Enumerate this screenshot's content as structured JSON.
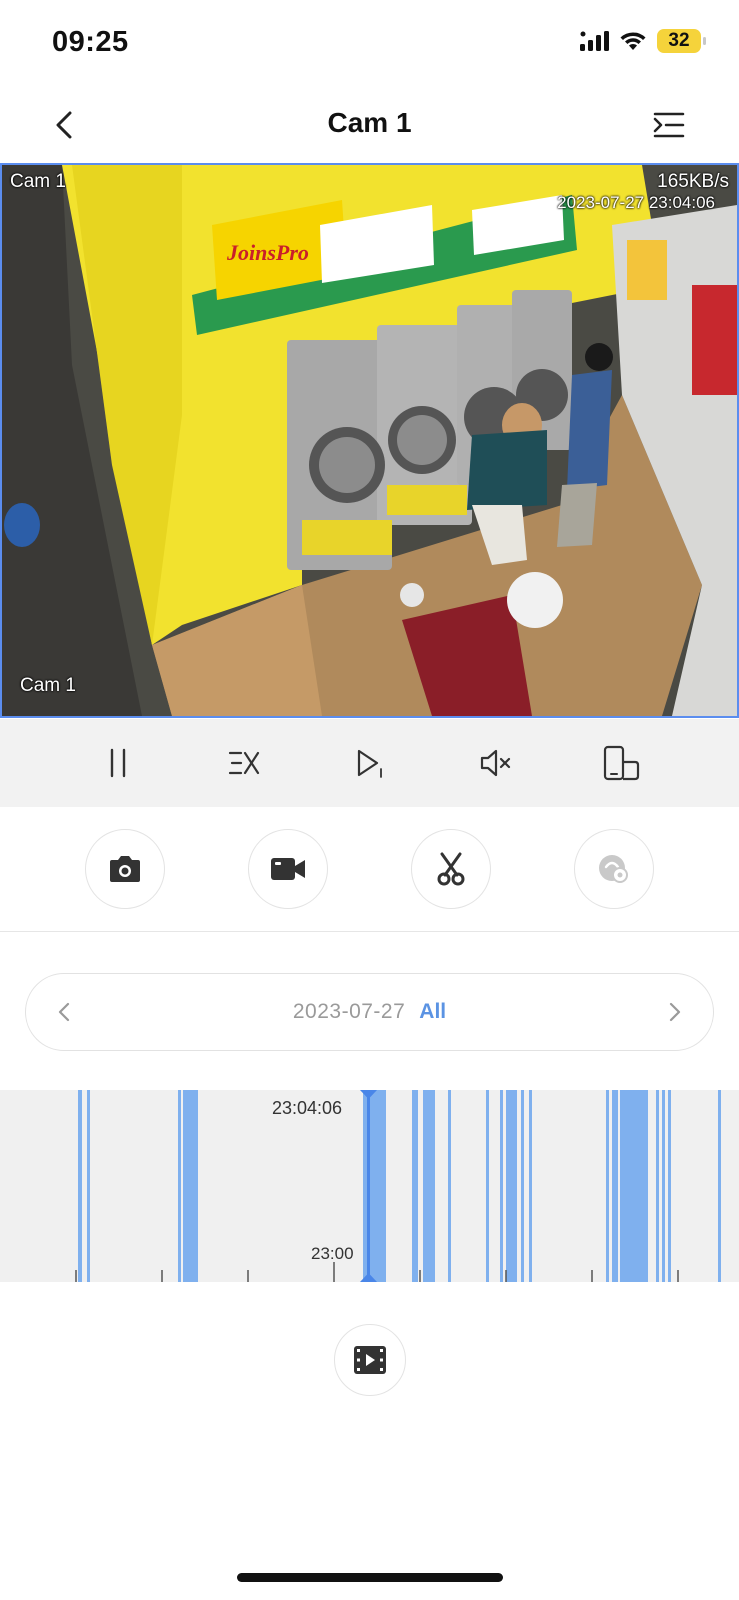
{
  "status_bar": {
    "time": "09:25",
    "battery": "32",
    "icons": [
      "signal-icon",
      "wifi-icon",
      "battery-icon"
    ]
  },
  "nav": {
    "title": "Cam 1",
    "back_icon": "chevron-left-icon",
    "menu_icon": "list-collapse-icon"
  },
  "video": {
    "osd_camera_top": "Cam 1",
    "osd_camera_bottom": "Cam 1",
    "bitrate": "165KB/s",
    "timestamp": "2023-07-27 23:04:06"
  },
  "controls": [
    {
      "name": "pause",
      "icon": "pause-icon"
    },
    {
      "name": "speed",
      "icon": "speed-1x-icon"
    },
    {
      "name": "frame-step",
      "icon": "play-frame-icon"
    },
    {
      "name": "mute",
      "icon": "speaker-muted-icon"
    },
    {
      "name": "orientation",
      "icon": "rotate-screen-icon"
    }
  ],
  "actions": [
    {
      "name": "snapshot",
      "icon": "camera-icon",
      "enabled": true
    },
    {
      "name": "record",
      "icon": "video-camera-icon",
      "enabled": true
    },
    {
      "name": "clip",
      "icon": "scissors-icon",
      "enabled": true
    },
    {
      "name": "smart-search",
      "icon": "smart-search-icon",
      "enabled": false
    }
  ],
  "date_selector": {
    "date": "2023-07-27",
    "filter": "All"
  },
  "timeline": {
    "current_time": "23:04:06",
    "tick_label": "23:00",
    "highlight_color": "#7fb0ee",
    "cursor_color": "#4a86e8"
  },
  "playback_icon": "video-list-icon"
}
